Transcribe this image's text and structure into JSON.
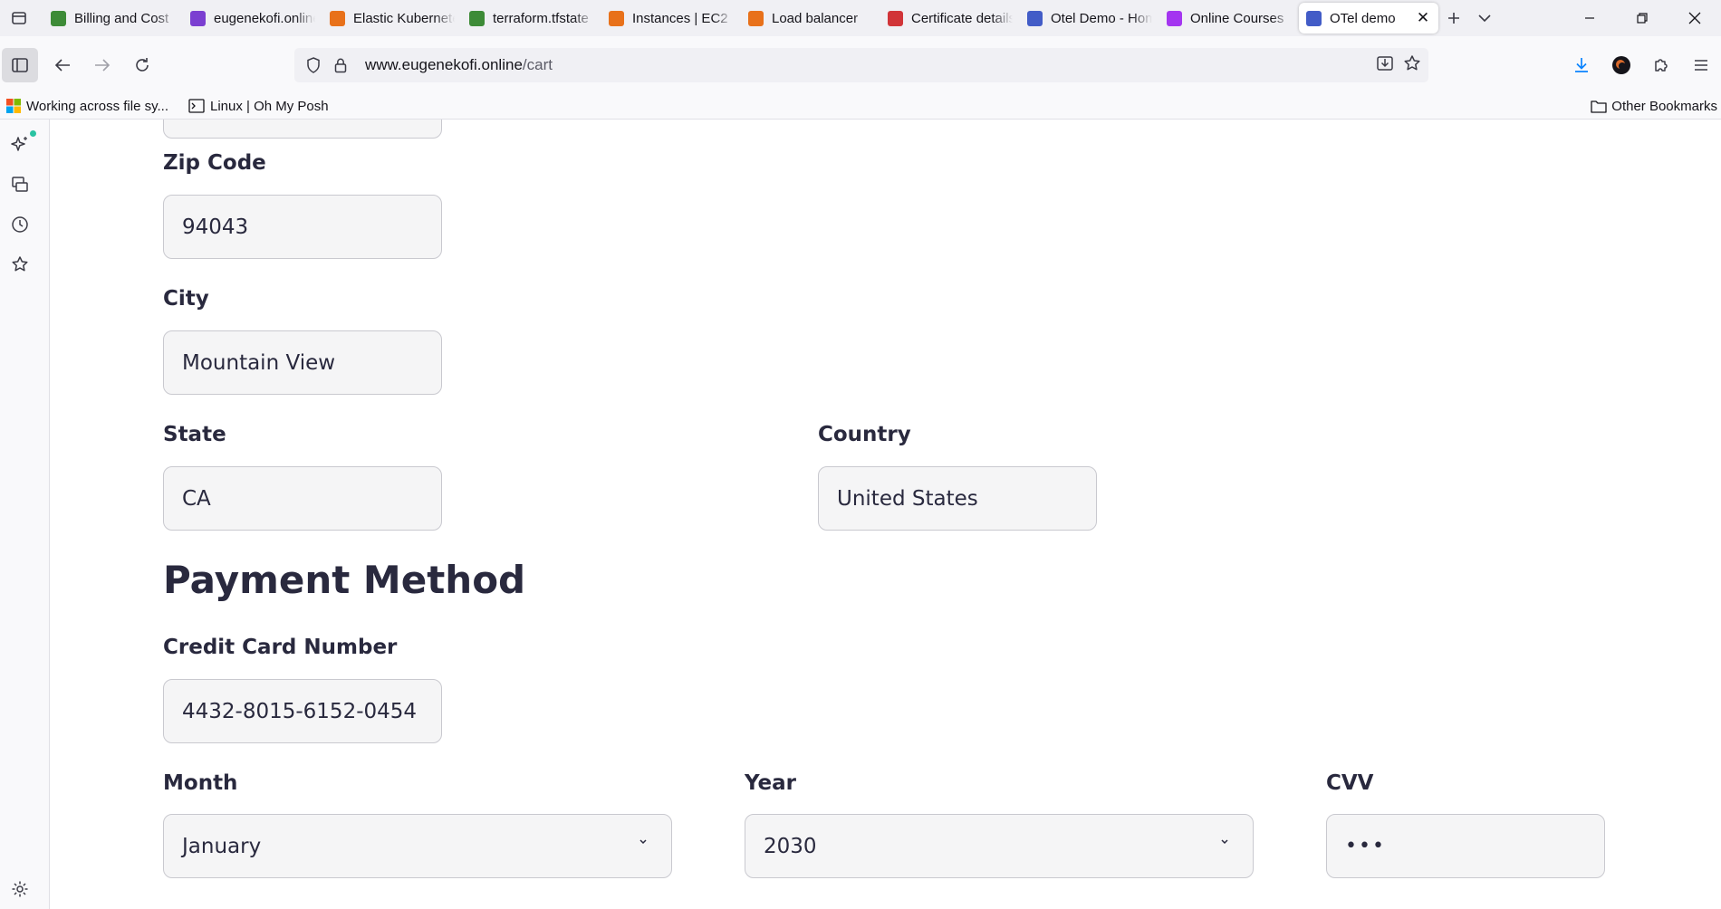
{
  "tabs": [
    {
      "title": "Billing and Cost",
      "icon": "aws-billing-icon",
      "color": "#3d8b37"
    },
    {
      "title": "eugenekofi.online",
      "icon": "route53-icon",
      "color": "#7b3fd1"
    },
    {
      "title": "Elastic Kubernetes",
      "icon": "eks-icon",
      "color": "#e8711a"
    },
    {
      "title": "terraform.tfstate",
      "icon": "s3-icon",
      "color": "#3d8b37"
    },
    {
      "title": "Instances | EC2",
      "icon": "ec2-icon",
      "color": "#e8711a"
    },
    {
      "title": "Load balancer",
      "icon": "ec2-icon",
      "color": "#e8711a"
    },
    {
      "title": "Certificate details",
      "icon": "acm-icon",
      "color": "#d13438"
    },
    {
      "title": "Otel Demo - Home",
      "icon": "otel-icon",
      "color": "#425cc7"
    },
    {
      "title": "Online Courses",
      "icon": "udemy-icon",
      "color": "#a435f0"
    },
    {
      "title": "OTel demo",
      "icon": "otel-icon",
      "color": "#425cc7",
      "active": true
    }
  ],
  "urlbar": {
    "domain": "www.eugenekofi.online",
    "path": "/cart"
  },
  "bookmarks": {
    "items": [
      {
        "label": "Working across file sy...",
        "icon": "microsoft-icon"
      },
      {
        "label": "Linux | Oh My Posh",
        "icon": "terminal-icon"
      }
    ],
    "other": "Other Bookmarks"
  },
  "form": {
    "zip_label": "Zip Code",
    "zip_value": "94043",
    "city_label": "City",
    "city_value": "Mountain View",
    "state_label": "State",
    "state_value": "CA",
    "country_label": "Country",
    "country_value": "United States",
    "payment_heading": "Payment Method",
    "cc_label": "Credit Card Number",
    "cc_value": "4432-8015-6152-0454",
    "month_label": "Month",
    "month_value": "January",
    "year_label": "Year",
    "year_value": "2030",
    "cvv_label": "CVV",
    "cvv_value": "•••"
  }
}
